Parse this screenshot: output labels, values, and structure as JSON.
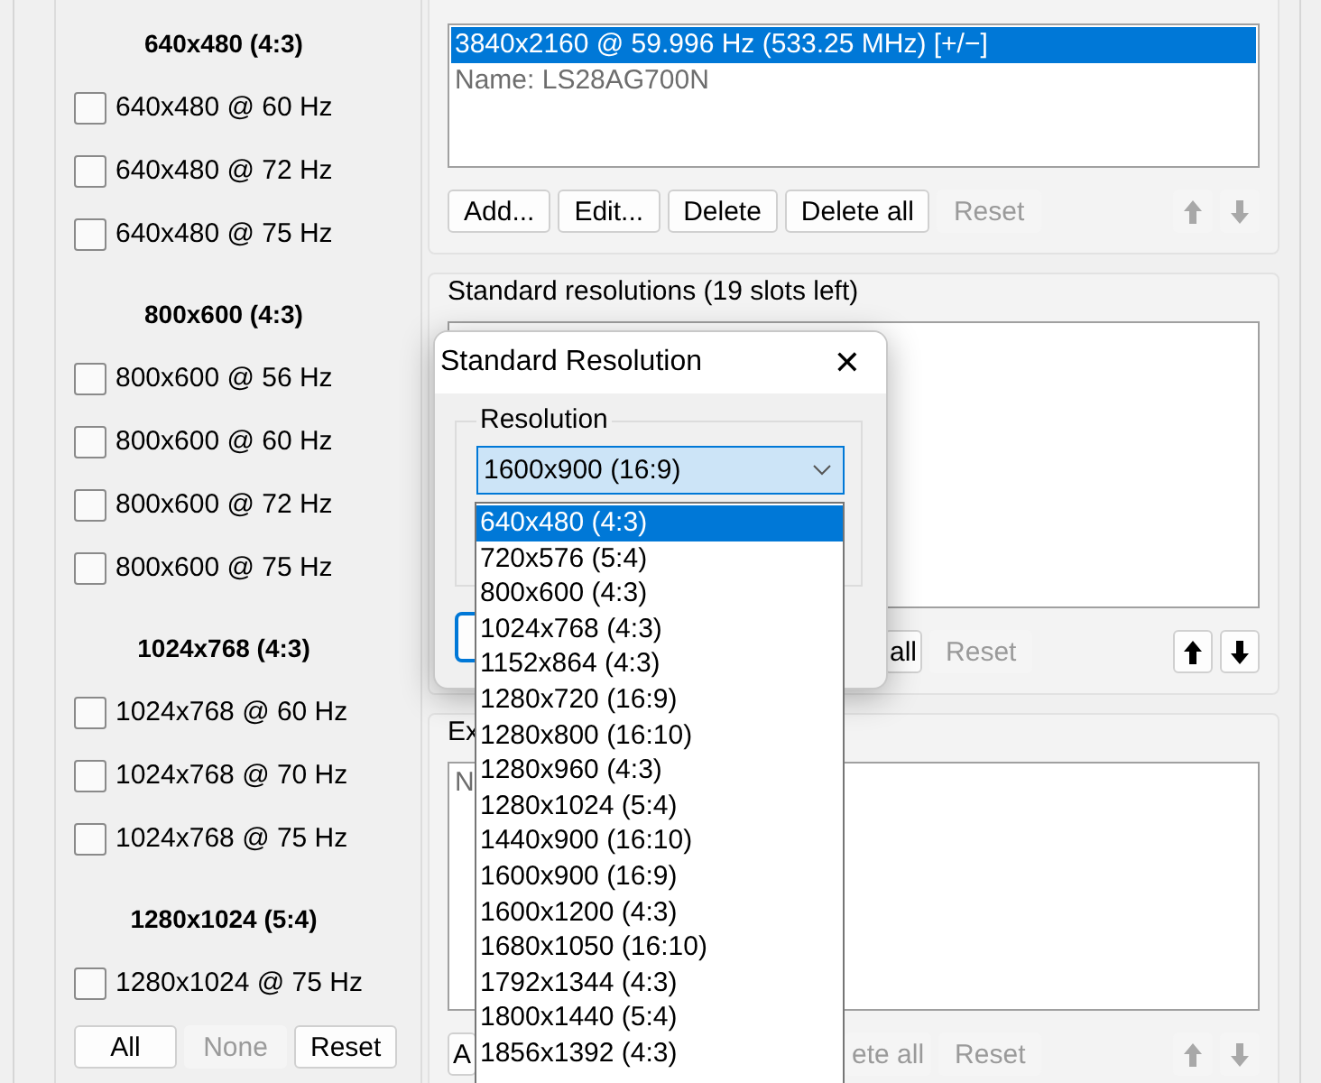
{
  "established": {
    "groups": [
      {
        "heading": "640x480 (4:3)",
        "modes": [
          {
            "label": "640x480 @ 60 Hz",
            "checked": false
          },
          {
            "label": "640x480 @ 72 Hz",
            "checked": false
          },
          {
            "label": "640x480 @ 75 Hz",
            "checked": false
          }
        ]
      },
      {
        "heading": "800x600 (4:3)",
        "modes": [
          {
            "label": "800x600 @ 56 Hz",
            "checked": false
          },
          {
            "label": "800x600 @ 60 Hz",
            "checked": false
          },
          {
            "label": "800x600 @ 72 Hz",
            "checked": false
          },
          {
            "label": "800x600 @ 75 Hz",
            "checked": false
          }
        ]
      },
      {
        "heading": "1024x768 (4:3)",
        "modes": [
          {
            "label": "1024x768 @ 60 Hz",
            "checked": false
          },
          {
            "label": "1024x768 @ 70 Hz",
            "checked": false
          },
          {
            "label": "1024x768 @ 75 Hz",
            "checked": false
          }
        ]
      },
      {
        "heading": "1280x1024 (5:4)",
        "modes": [
          {
            "label": "1280x1024 @ 75 Hz",
            "checked": false
          }
        ]
      }
    ],
    "buttons": [
      {
        "label": "All",
        "disabled": false
      },
      {
        "label": "None",
        "disabled": true
      },
      {
        "label": "Reset",
        "disabled": false
      }
    ]
  },
  "detailed": {
    "items": [
      {
        "text": "3840x2160 @ 59.996 Hz (533.25 MHz) [+/−]",
        "kind": "mode",
        "selected": true
      },
      {
        "text": "Name: LS28AG700N",
        "kind": "name",
        "selected": false
      }
    ],
    "buttons": [
      {
        "label": "Add...",
        "disabled": false
      },
      {
        "label": "Edit...",
        "disabled": false
      },
      {
        "label": "Delete",
        "disabled": false
      },
      {
        "label": "Delete all",
        "disabled": false
      },
      {
        "label": "Reset",
        "disabled": true
      }
    ],
    "arrows": [
      {
        "kind": "up",
        "disabled": true
      },
      {
        "kind": "down",
        "disabled": true
      }
    ]
  },
  "standard": {
    "title": "Standard resolutions (19 slots left)",
    "buttons": [
      {
        "label": "all",
        "disabled": false
      },
      {
        "label": "Reset",
        "disabled": true
      }
    ],
    "arrows": [
      {
        "kind": "up",
        "disabled": false
      },
      {
        "kind": "down",
        "disabled": false
      }
    ]
  },
  "extension": {
    "title": "Ex",
    "items": [
      {
        "text": "N",
        "kind": "name",
        "selected": false
      }
    ],
    "buttons": [
      {
        "label": "A",
        "disabled": false
      },
      {
        "label": "ete all",
        "disabled": true
      },
      {
        "label": "Reset",
        "disabled": true
      }
    ],
    "arrows": [
      {
        "kind": "up",
        "disabled": true
      },
      {
        "kind": "down",
        "disabled": true
      }
    ]
  },
  "dialog": {
    "title": "Standard Resolution",
    "close": "✕",
    "group": "Resolution",
    "combo": {
      "value": "1600x900 (16:9)"
    },
    "options": [
      {
        "label": "640x480 (4:3)",
        "selected": true
      },
      {
        "label": "720x576 (5:4)",
        "selected": false
      },
      {
        "label": "800x600 (4:3)",
        "selected": false
      },
      {
        "label": "1024x768 (4:3)",
        "selected": false
      },
      {
        "label": "1152x864 (4:3)",
        "selected": false
      },
      {
        "label": "1280x720 (16:9)",
        "selected": false
      },
      {
        "label": "1280x800 (16:10)",
        "selected": false
      },
      {
        "label": "1280x960 (4:3)",
        "selected": false
      },
      {
        "label": "1280x1024 (5:4)",
        "selected": false
      },
      {
        "label": "1440x900 (16:10)",
        "selected": false
      },
      {
        "label": "1600x900 (16:9)",
        "selected": false
      },
      {
        "label": "1600x1200 (4:3)",
        "selected": false
      },
      {
        "label": "1680x1050 (16:10)",
        "selected": false
      },
      {
        "label": "1792x1344 (4:3)",
        "selected": false
      },
      {
        "label": "1800x1440 (5:4)",
        "selected": false
      },
      {
        "label": "1856x1392 (4:3)",
        "selected": false
      }
    ]
  }
}
